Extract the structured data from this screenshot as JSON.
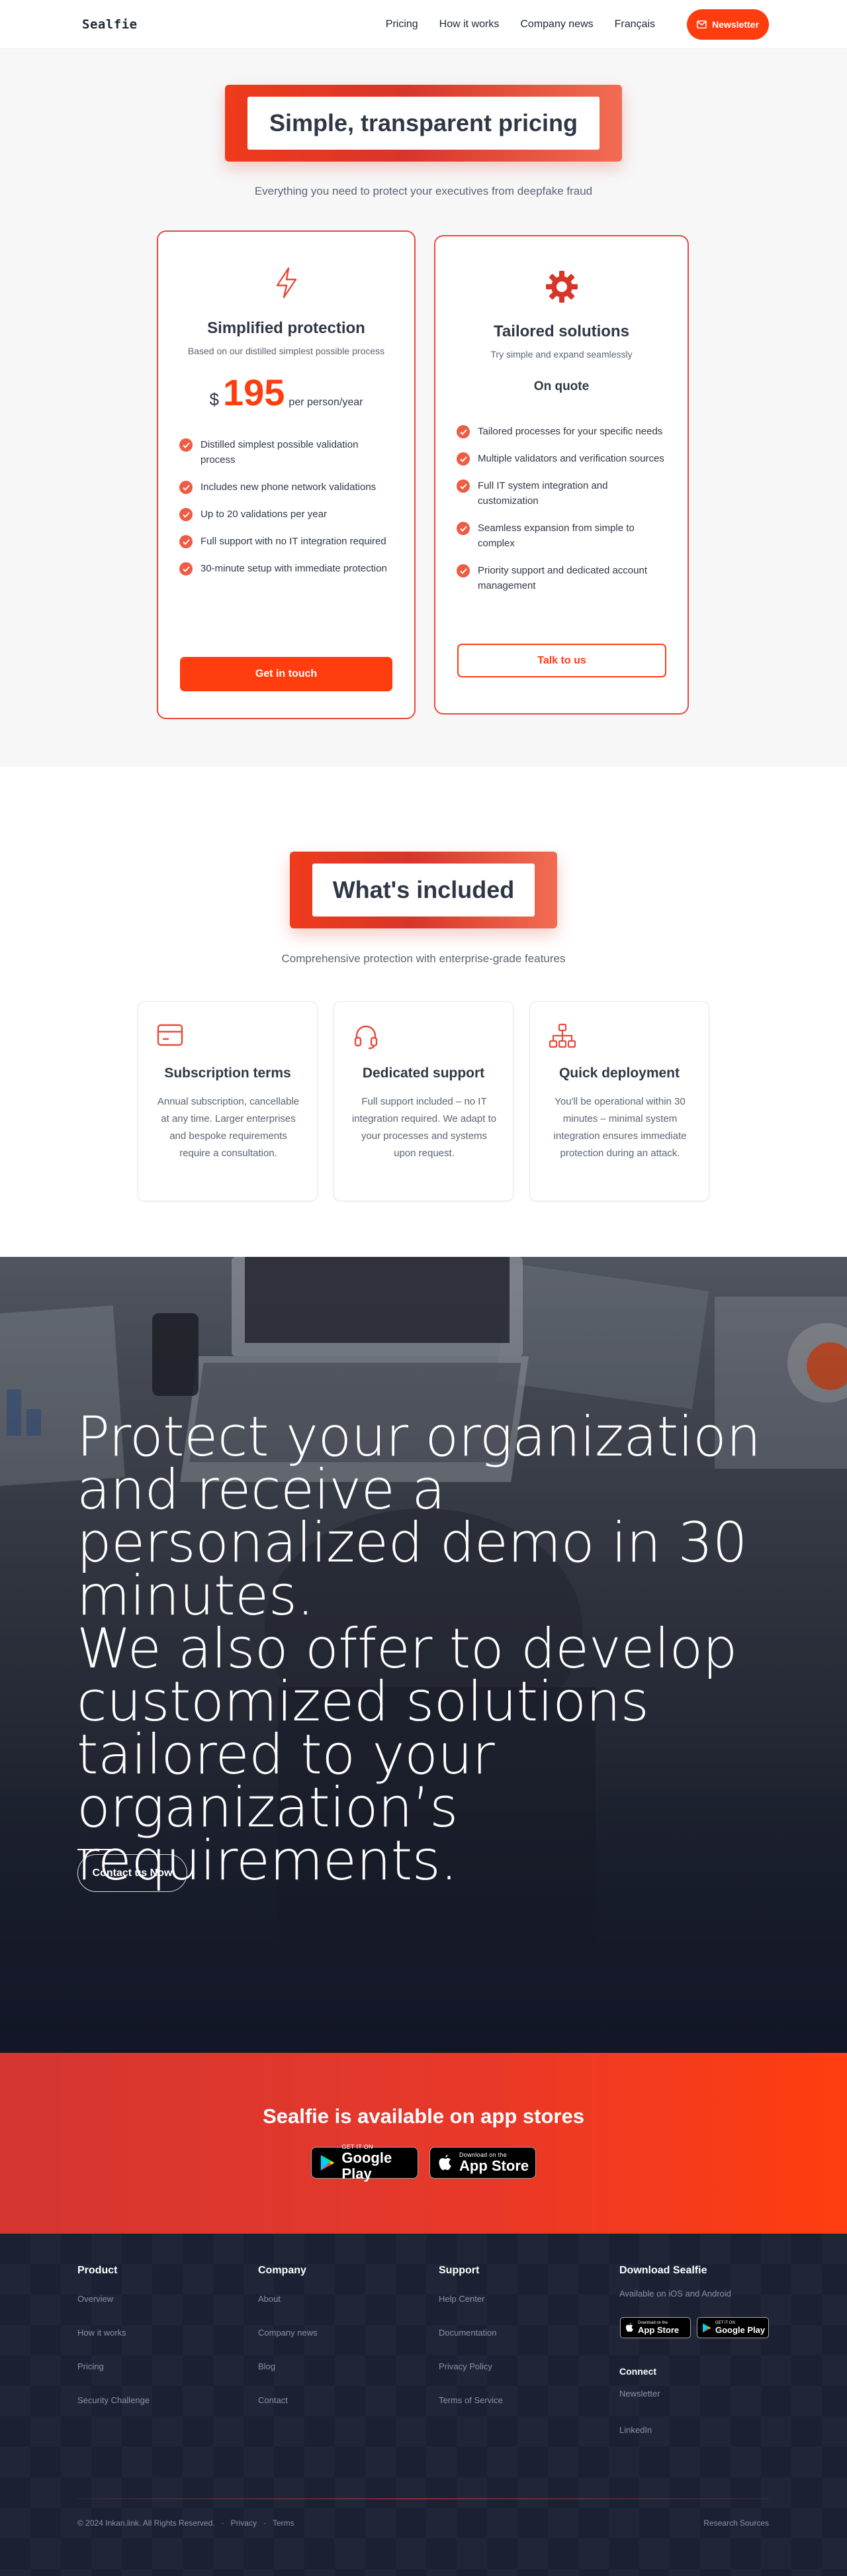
{
  "nav": {
    "brand": "Sealfie",
    "links": [
      "Pricing",
      "How it works",
      "Company news",
      "Français"
    ],
    "newsletter": "Newsletter"
  },
  "pricing": {
    "title": "Simple, transparent pricing",
    "subtitle": "Everything you need to protect your executives from deepfake fraud",
    "plans": [
      {
        "icon": "lightning-icon",
        "name": "Simplified protection",
        "tagline": "Based on our distilled simplest possible process",
        "currency": "$",
        "price": "195",
        "unit": "per person/year",
        "features": [
          "Distilled simplest possible validation process",
          "Includes new phone network validations",
          "Up to 20 validations per year",
          "Full support with no IT integration required",
          "30-minute setup with immediate protection"
        ],
        "cta": "Get in touch"
      },
      {
        "icon": "gear-icon",
        "name": "Tailored solutions",
        "tagline": "Try simple and expand seamlessly",
        "price_label": "On quote",
        "features": [
          "Tailored processes for your specific needs",
          "Multiple validators and verification sources",
          "Full IT system integration and customization",
          "Seamless expansion from simple to complex",
          "Priority support and dedicated account management"
        ],
        "cta": "Talk to us"
      }
    ]
  },
  "included": {
    "title": "What's included",
    "subtitle": "Comprehensive protection with enterprise-grade features",
    "items": [
      {
        "icon": "credit-card-icon",
        "title": "Subscription terms",
        "text": "Annual subscription, cancellable at any time. Larger enterprises and bespoke requirements require a consultation."
      },
      {
        "icon": "headset-icon",
        "title": "Dedicated support",
        "text": "Full support included – no IT integration required. We adapt to your processes and systems upon request."
      },
      {
        "icon": "network-icon",
        "title": "Quick deployment",
        "text": "You'll be operational within 30 minutes – minimal system integration ensures immediate protection during an attack."
      }
    ]
  },
  "hero": {
    "line1": "Protect your organization and receive a personalized demo in 30 minutes.",
    "line2": "We also offer to develop customized solutions tailored to your organization’s requirements.",
    "cta": "Contact us Now"
  },
  "apps": {
    "title": "Sealfie is available on app stores",
    "google_small": "GET IT ON",
    "google_big": "Google Play",
    "apple_small": "Download on the",
    "apple_big": "App Store"
  },
  "footer": {
    "product": {
      "head": "Product",
      "links": [
        "Overview",
        "How it works",
        "Pricing",
        "Security Challenge"
      ]
    },
    "company": {
      "head": "Company",
      "links": [
        "About",
        "Company news",
        "Blog",
        "Contact"
      ]
    },
    "support": {
      "head": "Support",
      "links": [
        "Help Center",
        "Documentation",
        "Privacy Policy",
        "Terms of Service"
      ]
    },
    "download": {
      "head": "Download Sealfie",
      "note": "Available on iOS and Android"
    },
    "connect": {
      "head": "Connect",
      "links": [
        "Newsletter",
        "LinkedIn"
      ]
    },
    "copyright": "© 2024 Inkan.link. All Rights Reserved.",
    "sep": "·",
    "privacy": "Privacy",
    "terms": "Terms",
    "research": "Research Sources"
  },
  "colors": {
    "accent": "#ff3d0f",
    "red": "#e84a3c",
    "footer_bg": "#1b2033"
  }
}
